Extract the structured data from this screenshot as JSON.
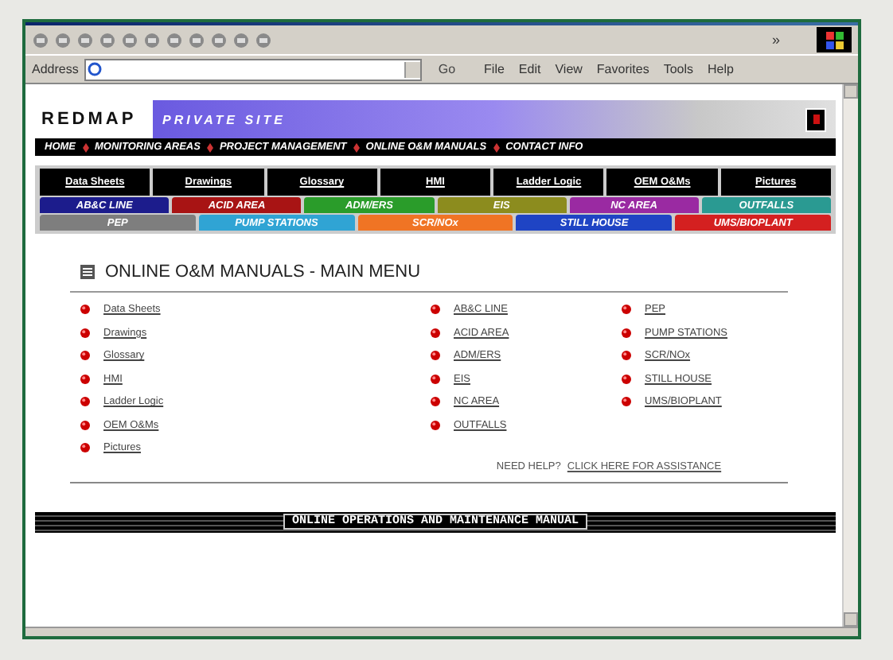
{
  "browser": {
    "chevron": "»",
    "address_label": "Address",
    "go_label": "Go",
    "menu": [
      "File",
      "Edit",
      "View",
      "Favorites",
      "Tools",
      "Help"
    ]
  },
  "banner": {
    "logo": "REDMAP",
    "subtitle": "PRIVATE SITE"
  },
  "nav": [
    "HOME",
    "MONITORING AREAS",
    "PROJECT MANAGEMENT",
    "ONLINE O&M MANUALS",
    "CONTACT INFO"
  ],
  "doc_buttons": [
    "Data Sheets",
    "Drawings",
    "Glossary",
    "HMI",
    "Ladder Logic",
    "OEM O&Ms",
    "Pictures"
  ],
  "area_rows": [
    [
      {
        "label": "AB&C LINE",
        "color": "#1c1c8c"
      },
      {
        "label": "ACID AREA",
        "color": "#a81414"
      },
      {
        "label": "ADM/ERS",
        "color": "#2a9c2a"
      },
      {
        "label": "EIS",
        "color": "#8c8c1e"
      },
      {
        "label": "NC AREA",
        "color": "#9a2aa2"
      },
      {
        "label": "OUTFALLS",
        "color": "#2a9a92"
      }
    ],
    [
      {
        "label": "PEP",
        "color": "#7e7e7e"
      },
      {
        "label": "PUMP STATIONS",
        "color": "#30a4d4"
      },
      {
        "label": "SCR/NOx",
        "color": "#f07424"
      },
      {
        "label": "STILL HOUSE",
        "color": "#1f44c4"
      },
      {
        "label": "UMS/BIOPLANT",
        "color": "#d42020"
      }
    ]
  ],
  "main_menu": {
    "title": "ONLINE O&M MANUALS - MAIN MENU",
    "columns": [
      [
        "Data Sheets",
        "Drawings",
        "Glossary",
        "HMI",
        "Ladder Logic",
        "OEM O&Ms",
        "Pictures"
      ],
      [
        "AB&C LINE",
        "ACID AREA",
        "ADM/ERS",
        "EIS",
        "NC AREA",
        "OUTFALLS"
      ],
      [
        "PEP",
        "PUMP STATIONS",
        "SCR/NOx",
        "STILL HOUSE",
        "UMS/BIOPLANT"
      ]
    ],
    "help_label": "NEED HELP?",
    "help_link": "CLICK HERE FOR ASSISTANCE"
  },
  "footer_banner": "ONLINE OPERATIONS AND MAINTENANCE MANUAL"
}
